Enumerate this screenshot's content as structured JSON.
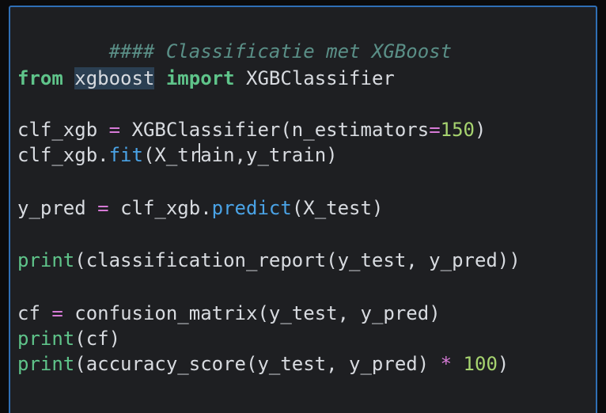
{
  "cell": {
    "lines": {
      "l1": {
        "comment": "#### Classificatie met XGBoost"
      },
      "l2": {
        "kw_from": "from",
        "module": "xgboost",
        "kw_import": "import",
        "name": "XGBClassifier"
      },
      "l3": {
        "var": "clf_xgb",
        "op": "=",
        "call": "XGBClassifier(n_estimators",
        "op2": "=",
        "num": "150",
        "tail": ")"
      },
      "l4": {
        "obj": "clf_xgb.",
        "fn": "fit",
        "args": "(X_train,y_train)"
      },
      "l5": {
        "var": "y_pred",
        "op": "=",
        "obj": "clf_xgb.",
        "fn": "predict",
        "args": "(X_test)"
      },
      "l6": {
        "fn": "print",
        "args": "(classification_report(y_test, y_pred))"
      },
      "l7": {
        "var": "cf",
        "op": "=",
        "call": "confusion_matrix(y_test, y_pred)"
      },
      "l8": {
        "fn": "print",
        "args": "(cf)"
      },
      "l9": {
        "fn": "print",
        "args": "(accuracy_score(y_test, y_pred)",
        "op": "*",
        "num": "100",
        "tail": ")"
      }
    }
  },
  "colors": {
    "editor_bg": "#1e1f22",
    "border": "#2f6fb5",
    "comment": "#5a8f87",
    "keyword": "#5fc48a",
    "operator": "#d67ad6",
    "number": "#a6d36f",
    "method": "#4aa3e6",
    "text": "#d8dbe0"
  }
}
